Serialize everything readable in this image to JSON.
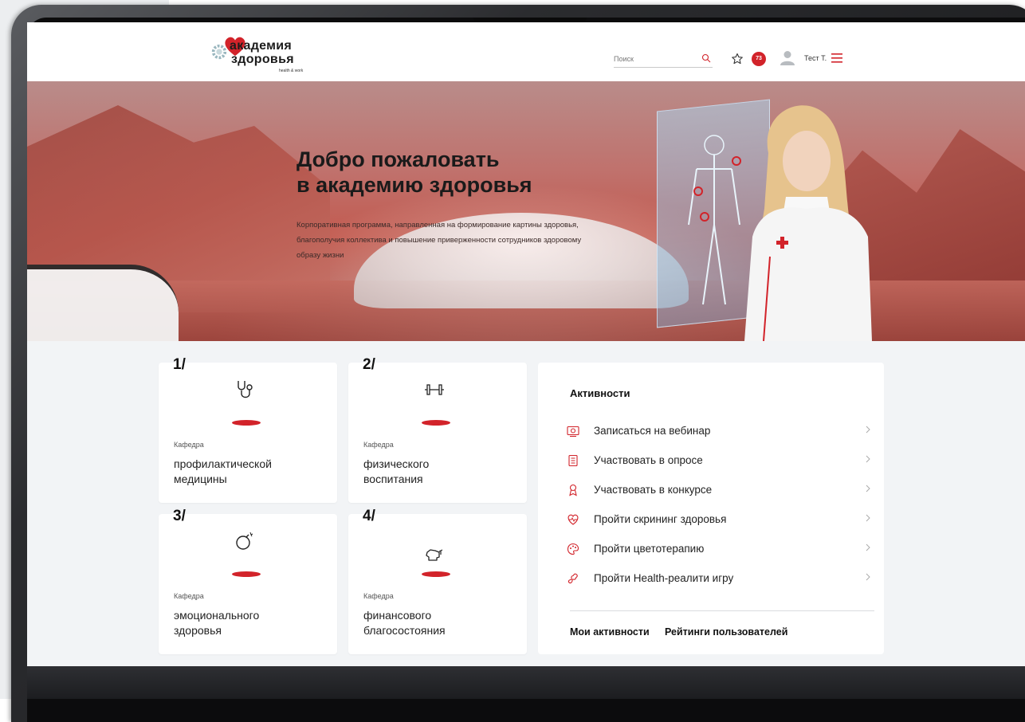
{
  "header": {
    "logo": {
      "line1": "академия",
      "line2": "здоровья",
      "line3": "health & work"
    },
    "search": {
      "placeholder": "Поиск"
    },
    "notifications_count": "73",
    "user_name": "Тест Т."
  },
  "hero": {
    "title": "Добро пожаловать\nв академию здоровья",
    "description": "Корпоративная программа, направленная на формирование картины здоровья, благополучия коллектива и повышение приверженности сотрудников здоровому образу жизни"
  },
  "departments": [
    {
      "number": "1/",
      "caption": "Кафедра",
      "title": "профилактической\nмедицины",
      "icon": "stethoscope-icon"
    },
    {
      "number": "2/",
      "caption": "Кафедра",
      "title": "физического\nвоспитания",
      "icon": "dumbbell-icon"
    },
    {
      "number": "3/",
      "caption": "Кафедра",
      "title": "эмоционального\nздоровья",
      "icon": "bomb-icon"
    },
    {
      "number": "4/",
      "caption": "Кафедра",
      "title": "финансового\nблагосостояния",
      "icon": "piggy-bank-icon"
    }
  ],
  "activities": {
    "title": "Активности",
    "items": [
      {
        "label": "Записаться на вебинар",
        "icon": "webinar-icon"
      },
      {
        "label": "Участвовать в опросе",
        "icon": "survey-icon"
      },
      {
        "label": "Участвовать в конкурсе",
        "icon": "award-icon"
      },
      {
        "label": "Пройти скрининг здоровья",
        "icon": "heart-pulse-icon"
      },
      {
        "label": "Пройти цветотерапию",
        "icon": "palette-icon"
      },
      {
        "label": "Пройти Health-реалити игру",
        "icon": "game-icon"
      }
    ],
    "links": {
      "my_activities": "Мои активности",
      "ratings": "Рейтинги пользователей"
    }
  },
  "colors": {
    "accent": "#d2232a",
    "background": "#f2f4f6"
  }
}
